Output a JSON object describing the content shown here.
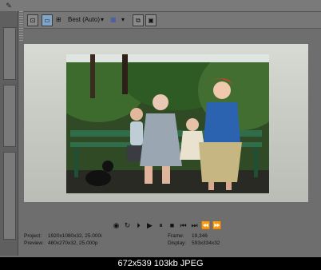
{
  "toolbar": {
    "quality_label": "Best (Auto)"
  },
  "status": {
    "project_label": "Project:",
    "project_value": "1920x1080x32, 25.000i",
    "preview_label": "Preview:",
    "preview_value": "480x270x32, 25.000p",
    "frame_label": "Frame:",
    "frame_value": "19,346",
    "display_label": "Display:",
    "display_value": "593x334x32"
  },
  "caption": "672x539 103kb JPEG"
}
